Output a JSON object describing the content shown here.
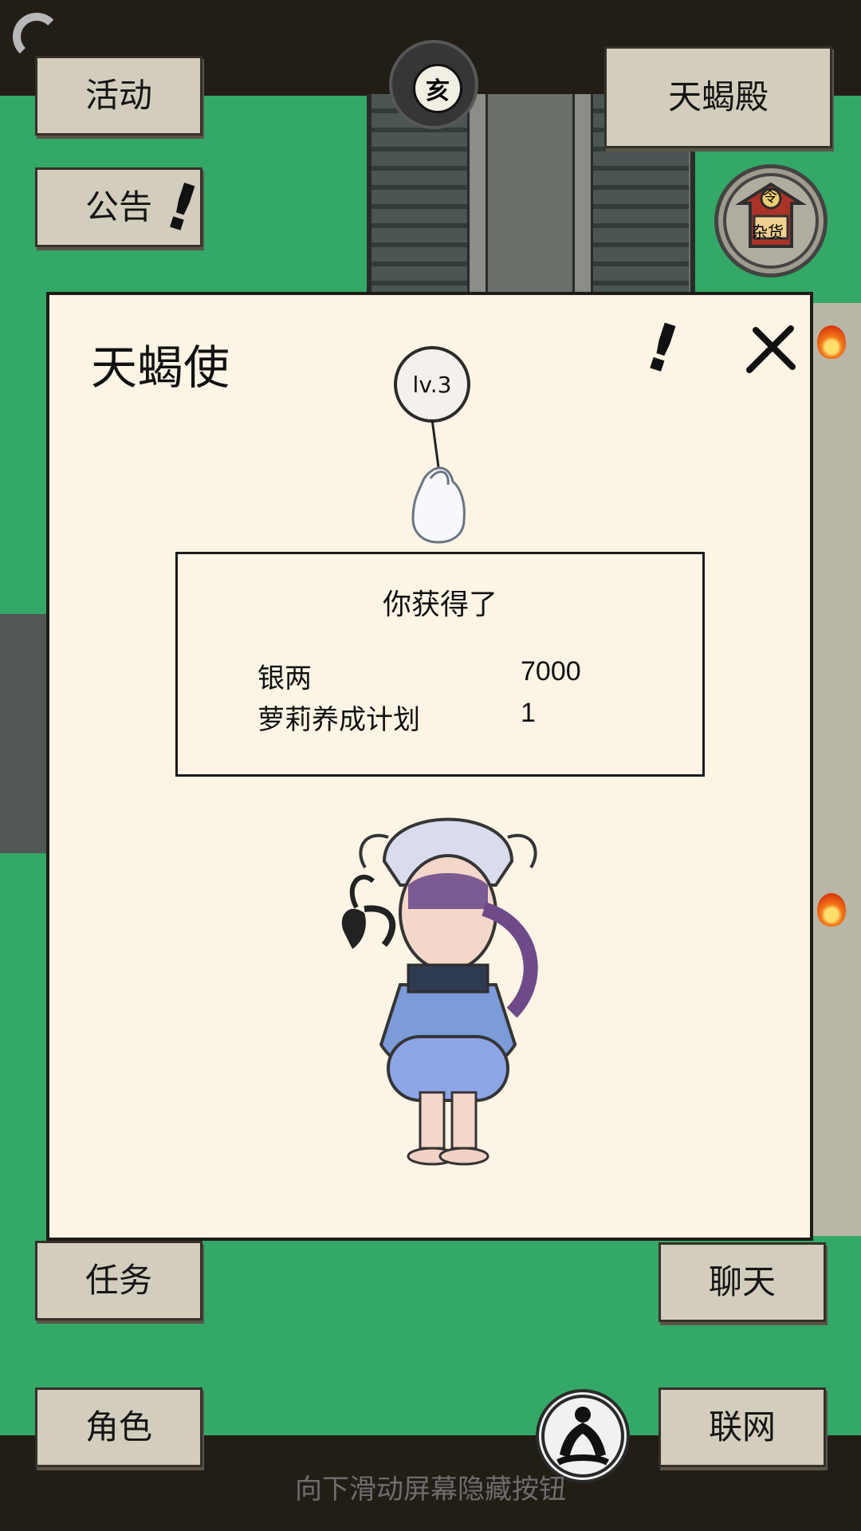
{
  "top_left_buttons": {
    "activity": "活动",
    "announcement": "公告"
  },
  "top_right_button": "天蝎殿",
  "top_emblem": "亥",
  "shop_icon_text": {
    "symbol": "令",
    "label": "杂货"
  },
  "dialog": {
    "title": "天蝎使",
    "level": "lv.3",
    "reward_title": "你获得了",
    "rewards": [
      {
        "name": "银两",
        "value": "7000"
      },
      {
        "name": "萝莉养成计划",
        "value": "1"
      }
    ]
  },
  "bottom_buttons": {
    "task": "任务",
    "role": "角色",
    "chat": "聊天",
    "network": "联网"
  },
  "footer_hint": "向下滑动屏幕隐藏按钮",
  "colors": {
    "green": "#34a866",
    "dialog": "#fcf4e4",
    "button": "#d3cdbd"
  },
  "icons": {
    "loading": "loading-arc-icon",
    "exclaim": "exclamation-icon",
    "close": "close-icon",
    "shop": "shop-icon",
    "meditation": "meditation-icon",
    "reward_bag": "money-bag-icon",
    "character": "character-avatar"
  }
}
